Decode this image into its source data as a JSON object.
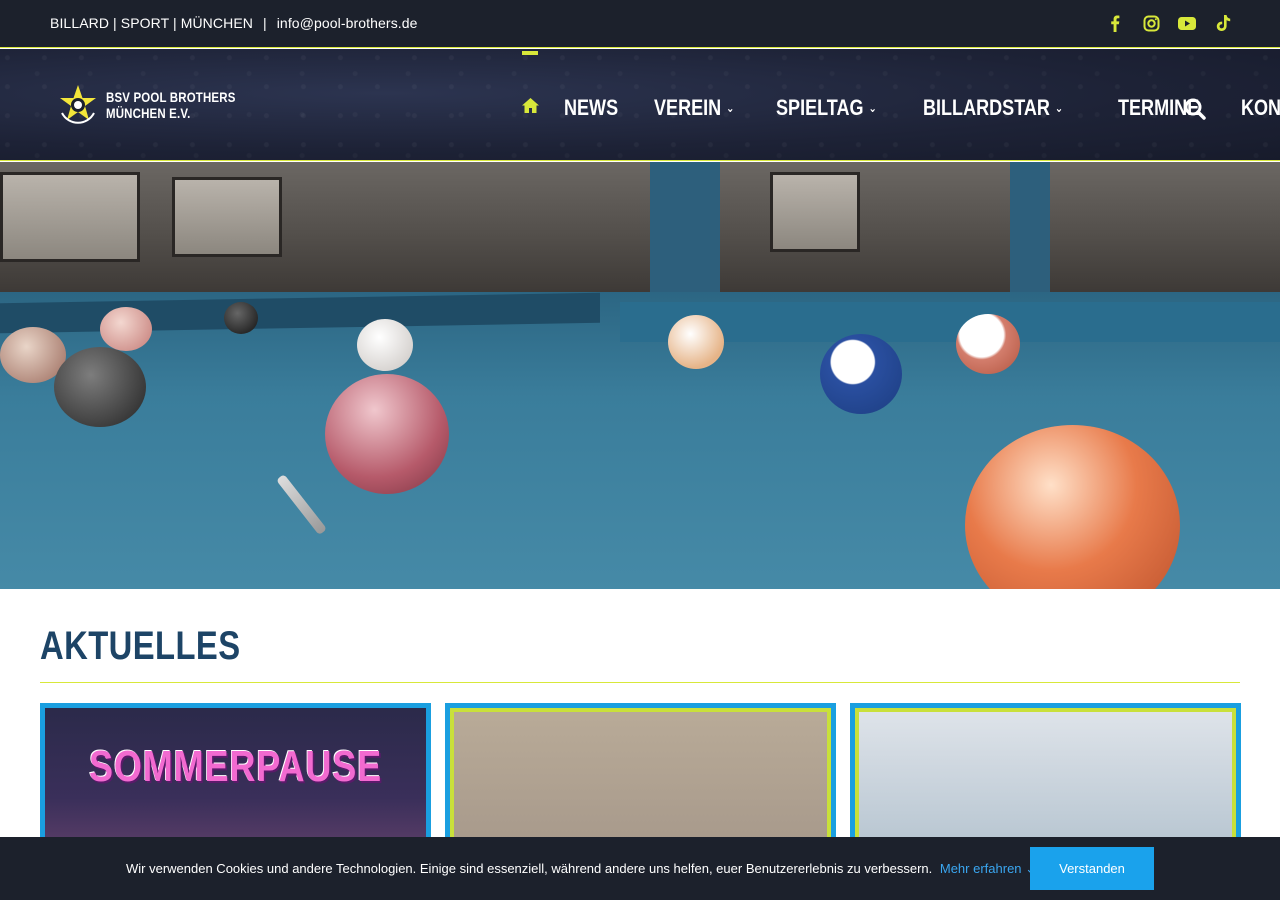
{
  "topbar": {
    "text_1": "BILLARD | SPORT | MÜNCHEN",
    "separator": "|",
    "email": "info@pool-brothers.de",
    "social": [
      "facebook-icon",
      "instagram-icon",
      "youtube-icon",
      "tiktok-icon"
    ]
  },
  "header": {
    "logo_line_1": "BSV POOL BROTHERS",
    "logo_line_2": "MÜNCHEN E.V.",
    "nav": {
      "news": "NEWS",
      "verein": "VEREIN",
      "spieltag": "SPIELTAG",
      "billardstar": "BILLARDSTAR",
      "termine": "TERMINE",
      "kontakt": "KONTAKT"
    }
  },
  "colors": {
    "accent_yellow": "#d8e83a",
    "dark_bg": "#1c212c",
    "heading_blue": "#1d4466",
    "card_border_blue": "#1a9fe0",
    "button_blue": "#1aa2ec"
  },
  "main": {
    "section_title": "AKTUELLES",
    "cards": [
      {
        "title": "SOMMERPAUSE"
      }
    ]
  },
  "cookie": {
    "text": "Wir verwenden Cookies und andere Technologien. Einige sind essenziell, während andere uns helfen, euer Benutzererlebnis zu verbessern.",
    "link": "Mehr erfahren",
    "button": "Verstanden"
  }
}
